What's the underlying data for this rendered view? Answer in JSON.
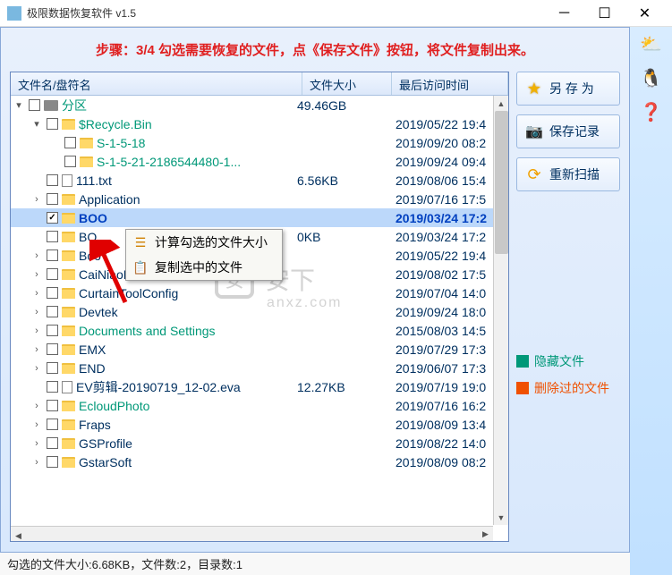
{
  "window": {
    "title": "极限数据恢复软件 v1.5"
  },
  "instruction": "步骤：3/4 勾选需要恢复的文件，点《保存文件》按钮，将文件复制出来。",
  "columns": {
    "name": "文件名/盘符名",
    "size": "文件大小",
    "time": "最后访问时间"
  },
  "root": {
    "label": "分区",
    "size": "49.46GB"
  },
  "rows": [
    {
      "indent": 1,
      "exp": "▾",
      "icon": "folder",
      "label": "$Recycle.Bin",
      "hidden": true,
      "size": "",
      "time": "2019/05/22 19:4"
    },
    {
      "indent": 2,
      "exp": "",
      "icon": "folder",
      "label": "S-1-5-18",
      "hidden": true,
      "size": "",
      "time": "2019/09/20 08:2"
    },
    {
      "indent": 2,
      "exp": "",
      "icon": "folder",
      "label": "S-1-5-21-2186544480-1...",
      "hidden": true,
      "size": "",
      "time": "2019/09/24 09:4"
    },
    {
      "indent": 1,
      "exp": "",
      "icon": "file",
      "label": "111.txt",
      "size": "6.56KB",
      "time": "2019/08/06 15:4"
    },
    {
      "indent": 1,
      "exp": "›",
      "icon": "folder",
      "label": "Application",
      "size": "",
      "time": "2019/07/16 17:5"
    },
    {
      "indent": 1,
      "exp": "",
      "icon": "folder",
      "label": "BOO",
      "selected": true,
      "checked": true,
      "size": "",
      "time": "2019/03/24 17:2"
    },
    {
      "indent": 1,
      "exp": "",
      "icon": "folder",
      "label": "BO",
      "size": "0KB",
      "time": "2019/03/24 17:2"
    },
    {
      "indent": 1,
      "exp": "›",
      "icon": "folder",
      "label": "Boo",
      "size": "",
      "time": "2019/05/22 19:4"
    },
    {
      "indent": 1,
      "exp": "›",
      "icon": "folder",
      "label": "CaiNiaoPrint",
      "size": "",
      "time": "2019/08/02 17:5"
    },
    {
      "indent": 1,
      "exp": "›",
      "icon": "folder",
      "label": "CurtainToolConfig",
      "size": "",
      "time": "2019/07/04 14:0"
    },
    {
      "indent": 1,
      "exp": "›",
      "icon": "folder",
      "label": "Devtek",
      "size": "",
      "time": "2019/09/24 18:0"
    },
    {
      "indent": 1,
      "exp": "›",
      "icon": "folder",
      "label": "Documents and Settings",
      "hidden": true,
      "size": "",
      "time": "2015/08/03 14:5"
    },
    {
      "indent": 1,
      "exp": "›",
      "icon": "folder",
      "label": "EMX",
      "size": "",
      "time": "2019/07/29 17:3"
    },
    {
      "indent": 1,
      "exp": "›",
      "icon": "folder",
      "label": "END",
      "size": "",
      "time": "2019/06/07 17:3"
    },
    {
      "indent": 1,
      "exp": "",
      "icon": "file",
      "label": "EV剪辑-20190719_12-02.eva",
      "size": "12.27KB",
      "time": "2019/07/19 19:0"
    },
    {
      "indent": 1,
      "exp": "›",
      "icon": "folder",
      "label": "EcloudPhoto",
      "hidden": true,
      "size": "",
      "time": "2019/07/16 16:2"
    },
    {
      "indent": 1,
      "exp": "›",
      "icon": "folder",
      "label": "Fraps",
      "size": "",
      "time": "2019/08/09 13:4"
    },
    {
      "indent": 1,
      "exp": "›",
      "icon": "folder",
      "label": "GSProfile",
      "size": "",
      "time": "2019/08/22 14:0"
    },
    {
      "indent": 1,
      "exp": "›",
      "icon": "folder",
      "label": "GstarSoft",
      "size": "",
      "time": "2019/08/09 08:2"
    }
  ],
  "buttons": {
    "save_as": "另 存 为",
    "save_record": "保存记录",
    "rescan": "重新扫描"
  },
  "legend": {
    "hidden": "隐藏文件",
    "deleted": "删除过的文件"
  },
  "context_menu": {
    "calc_size": "计算勾选的文件大小",
    "copy_selected": "复制选中的文件"
  },
  "status": "勾选的文件大小:6.68KB，文件数:2，目录数:1",
  "watermark": {
    "main": "安下",
    "sub": "anxz.com"
  }
}
